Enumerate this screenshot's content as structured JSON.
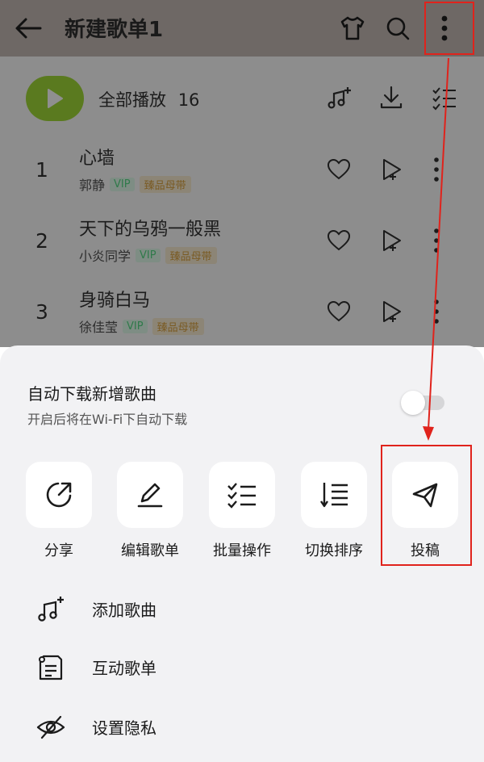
{
  "header": {
    "title": "新建歌单1",
    "icons": [
      "back-arrow-icon",
      "tshirt-icon",
      "search-icon",
      "more-vertical-icon"
    ]
  },
  "playlist": {
    "play_all_label": "全部播放",
    "count": "16"
  },
  "songs": [
    {
      "index": "1",
      "title": "心墙",
      "artist": "郭静",
      "vip": "VIP",
      "quality": "臻品母带"
    },
    {
      "index": "2",
      "title": "天下的乌鸦一般黑",
      "artist": "小炎同学",
      "vip": "VIP",
      "quality": "臻品母带"
    },
    {
      "index": "3",
      "title": "身骑白马",
      "artist": "徐佳莹",
      "vip": "VIP",
      "quality": "臻品母带"
    }
  ],
  "sheet": {
    "auto_download": {
      "title": "自动下载新增歌曲",
      "subtitle": "开启后将在Wi-Fi下自动下载",
      "enabled": false
    },
    "actions": [
      {
        "label": "分享",
        "icon": "share-icon"
      },
      {
        "label": "编辑歌单",
        "icon": "edit-pencil-icon"
      },
      {
        "label": "批量操作",
        "icon": "batch-checklist-icon"
      },
      {
        "label": "切换排序",
        "icon": "sort-icon"
      },
      {
        "label": "投稿",
        "icon": "paper-plane-icon"
      }
    ],
    "menu": [
      {
        "label": "添加歌曲",
        "icon": "add-music-icon"
      },
      {
        "label": "互动歌单",
        "icon": "interactive-playlist-icon"
      },
      {
        "label": "设置隐私",
        "icon": "privacy-eye-off-icon"
      }
    ]
  },
  "colors": {
    "highlight": "#e0231c",
    "play_button": "#5a7a1f",
    "sheet_bg": "#f2f2f4"
  }
}
